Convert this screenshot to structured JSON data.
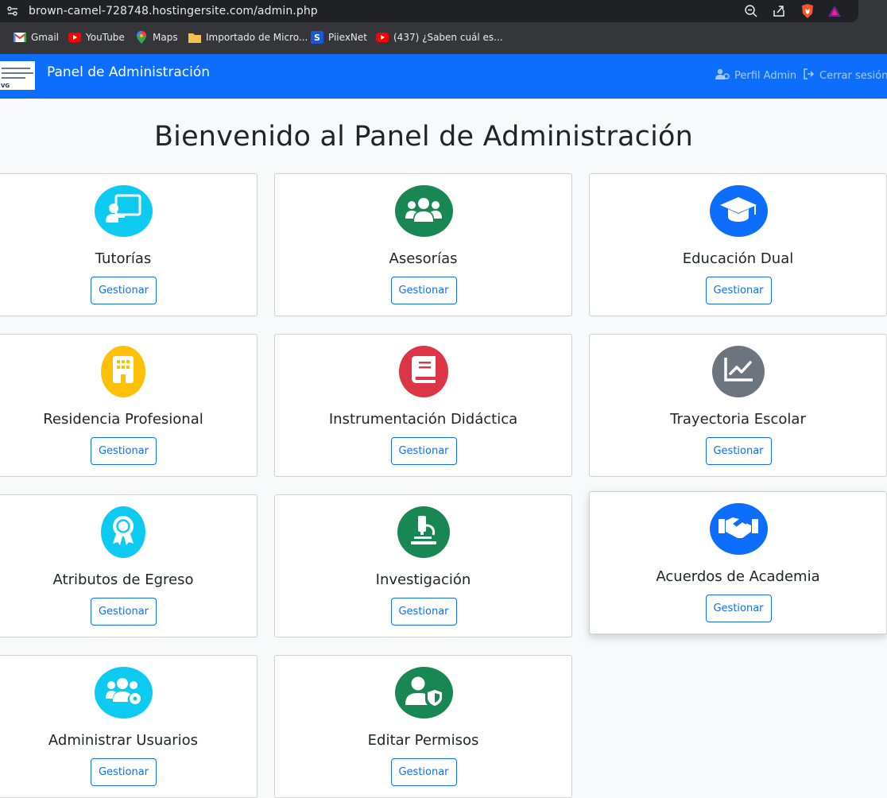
{
  "browser": {
    "url": "brown-camel-728748.hostingersite.com/admin.php",
    "bookmarks": [
      {
        "label": "Gmail",
        "icon": "gmail-icon"
      },
      {
        "label": "YouTube",
        "icon": "youtube-icon"
      },
      {
        "label": "Maps",
        "icon": "maps-icon"
      },
      {
        "label": "Importado de Micro...",
        "icon": "folder-icon"
      },
      {
        "label": "PiiexNet",
        "icon": "piiexnet-icon"
      },
      {
        "label": "(437) ¿Saben cuál es...",
        "icon": "youtube-icon"
      }
    ]
  },
  "navbar": {
    "brand": "Panel de Administración",
    "logo_text": "VG",
    "profile_label": "Perfil Admin",
    "logout_label": "Cerrar sesión",
    "color": "#0d6efd"
  },
  "page": {
    "title": "Bienvenido al Panel de Administración"
  },
  "cards": [
    {
      "title": "Tutorías",
      "button": "Gestionar",
      "icon": "chalkboard-teacher-icon",
      "color": "#0dcaf0"
    },
    {
      "title": "Asesorías",
      "button": "Gestionar",
      "icon": "users-icon",
      "color": "#198754"
    },
    {
      "title": "Educación Dual",
      "button": "Gestionar",
      "icon": "graduation-cap-icon",
      "color": "#0d6efd"
    },
    {
      "title": "Residencia Profesional",
      "button": "Gestionar",
      "icon": "building-icon",
      "color": "#ffc107"
    },
    {
      "title": "Instrumentación Didáctica",
      "button": "Gestionar",
      "icon": "book-icon",
      "color": "#dc3545"
    },
    {
      "title": "Trayectoria Escolar",
      "button": "Gestionar",
      "icon": "chart-line-icon",
      "color": "#6c757d"
    },
    {
      "title": "Atributos de Egreso",
      "button": "Gestionar",
      "icon": "award-icon",
      "color": "#0dcaf0"
    },
    {
      "title": "Investigación",
      "button": "Gestionar",
      "icon": "microscope-icon",
      "color": "#198754"
    },
    {
      "title": "Acuerdos de Academia",
      "button": "Gestionar",
      "icon": "handshake-icon",
      "color": "#0d6efd"
    },
    {
      "title": "Administrar Usuarios",
      "button": "Gestionar",
      "icon": "users-cog-icon",
      "color": "#0dcaf0"
    },
    {
      "title": "Editar Permisos",
      "button": "Gestionar",
      "icon": "user-shield-icon",
      "color": "#198754"
    }
  ]
}
